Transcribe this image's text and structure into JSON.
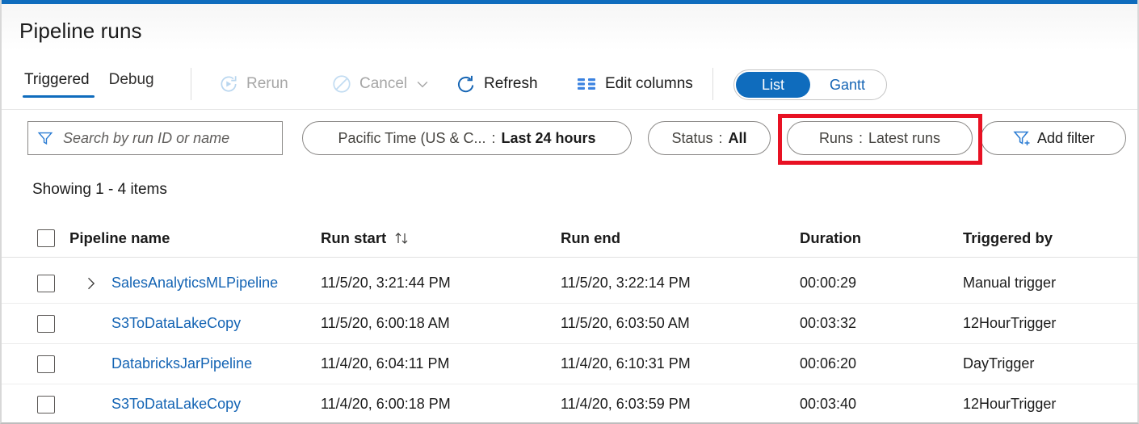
{
  "header": {
    "title": "Pipeline runs"
  },
  "tabs": [
    {
      "label": "Triggered",
      "name": "tab-triggered",
      "active": true
    },
    {
      "label": "Debug",
      "name": "tab-debug",
      "active": false
    }
  ],
  "toolbar": {
    "rerun_label": "Rerun",
    "cancel_label": "Cancel",
    "refresh_label": "Refresh",
    "edit_columns_label": "Edit columns",
    "view_toggle": {
      "options": [
        "List",
        "Gantt"
      ],
      "selected": "List"
    }
  },
  "filters": {
    "search_placeholder": "Search by run ID or name",
    "search_value": "",
    "time": {
      "key": "Pacific Time (US & C...",
      "sep": ":",
      "value": "Last 24 hours"
    },
    "status": {
      "key": "Status",
      "sep": ":",
      "value": "All"
    },
    "runs": {
      "key": "Runs",
      "sep": ":",
      "value": "Latest runs"
    },
    "add_filter_label": "Add filter"
  },
  "table": {
    "showing": "Showing 1 - 4 items",
    "columns": {
      "pipeline_name": "Pipeline name",
      "run_start": "Run start",
      "run_end": "Run end",
      "duration": "Duration",
      "triggered_by": "Triggered by"
    },
    "rows": [
      {
        "pipeline_name": "SalesAnalyticsMLPipeline",
        "run_start": "11/5/20, 3:21:44 PM",
        "run_end": "11/5/20, 3:22:14 PM",
        "duration": "00:00:29",
        "triggered_by": "Manual trigger",
        "expandable": true
      },
      {
        "pipeline_name": "S3ToDataLakeCopy",
        "run_start": "11/5/20, 6:00:18 AM",
        "run_end": "11/5/20, 6:03:50 AM",
        "duration": "00:03:32",
        "triggered_by": "12HourTrigger",
        "expandable": false
      },
      {
        "pipeline_name": "DatabricksJarPipeline",
        "run_start": "11/4/20, 6:04:11 PM",
        "run_end": "11/4/20, 6:10:31 PM",
        "duration": "00:06:20",
        "triggered_by": "DayTrigger",
        "expandable": false
      },
      {
        "pipeline_name": "S3ToDataLakeCopy",
        "run_start": "11/4/20, 6:00:18 PM",
        "run_end": "11/4/20, 6:03:59 PM",
        "duration": "00:03:40",
        "triggered_by": "12HourTrigger",
        "expandable": false
      }
    ]
  },
  "annotation": {
    "highlighted_element": "Runs : Latest runs",
    "color": "#e81123"
  },
  "colors": {
    "accent": "#0f6cbd",
    "link": "#1464b4",
    "disabled": "#a6a6a6",
    "highlight": "#e81123"
  }
}
